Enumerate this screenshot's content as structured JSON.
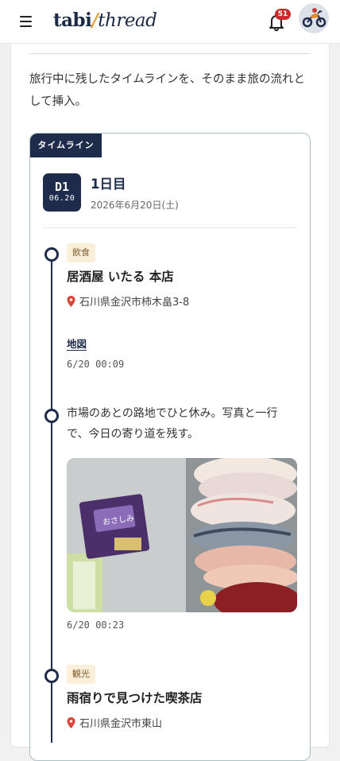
{
  "header": {
    "logo_part1": "tabi",
    "logo_slash": "/",
    "logo_part2": "thread",
    "notification_count": "51"
  },
  "intro_text": "旅行中に残したタイムラインを、そのまま旅の流れとして挿入。",
  "timeline": {
    "tag_label": "タイムライン",
    "day": {
      "badge_day": "D1",
      "badge_date": "06.20",
      "title": "1日目",
      "date": "2026年6月20日(土)"
    },
    "entries": [
      {
        "category": "飲食",
        "title": "居酒屋 いたる 本店",
        "location": "石川県金沢市柿木畠3-8",
        "map_link": "地図",
        "timestamp": "6/20 00:09"
      },
      {
        "text": "市場のあとの路地でひと休み。写真と一行で、今日の寄り道を残す。",
        "photo_label": "おさしみ",
        "timestamp": "6/20 00:23"
      },
      {
        "category": "観光",
        "title": "雨宿りで見つけた喫茶店",
        "location": "石川県金沢市東山"
      }
    ]
  },
  "colors": {
    "navy": "#1e2b4a",
    "accent": "#e0a33a",
    "badge_red": "#cc2b2b",
    "tag_bg": "#fcefd9"
  }
}
